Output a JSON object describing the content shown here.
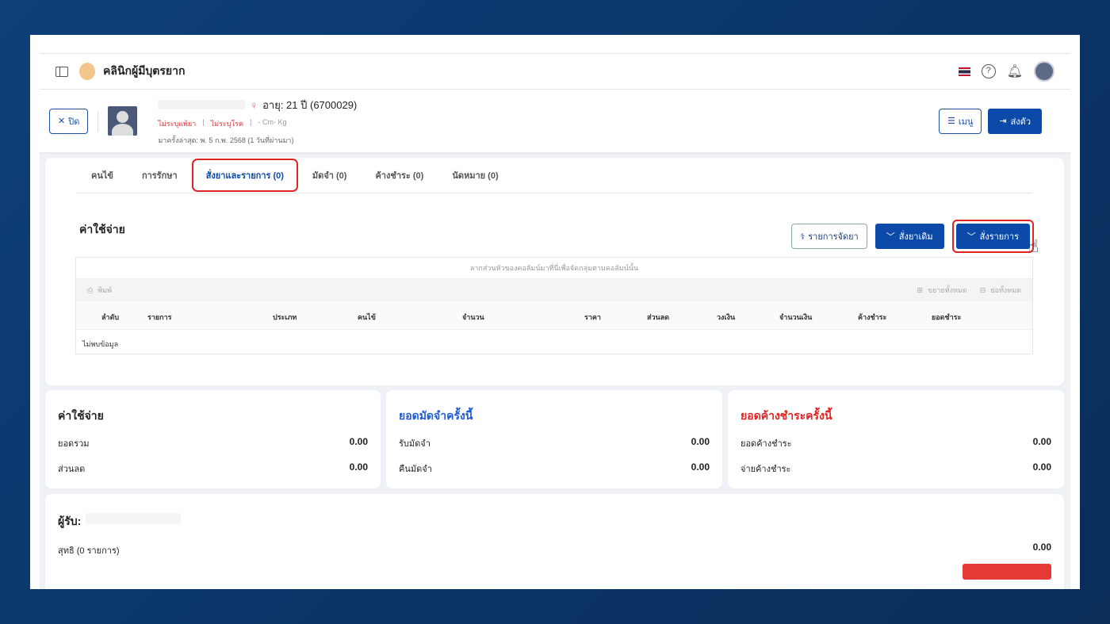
{
  "header": {
    "title": "คลินิกผู้มีบุตรยาก"
  },
  "patient": {
    "close_label": "ปิด",
    "age": "อายุ: 21 ปี (6700029)",
    "allergy": "ไม่ระบุแพ้ยา",
    "disease": "ไม่ระบุโรค",
    "size": "- Cm- Kg",
    "last_visit": "มาครั้งล่าสุด: พ. 5 ก.พ. 2568 (1 วันที่ผ่านมา)",
    "menu_label": "เมนู",
    "send_label": "ส่งตัว"
  },
  "tabs": [
    "คนไข้",
    "การรักษา",
    "สั่งยาและรายการ (0)",
    "มัดจำ (0)",
    "ค้างชำระ (0)",
    "นัดหมาย (0)"
  ],
  "section": {
    "title": "ค่าใช้จ่าย",
    "btn_dispense": "รายการจัดยา",
    "btn_old_drug": "สั่งยาเดิม",
    "btn_order": "สั่งรายการ"
  },
  "grid": {
    "group_hint": "ลากส่วนหัวของคอลัมน์มาที่นี่เพื่อจัดกลุ่มตามคอลัมน์นั้น",
    "print": "พิมพ์",
    "expand_all": "ขยายทั้งหมด",
    "collapse_all": "ย่อทั้งหมด",
    "columns": [
      "ลำดับ",
      "รายการ",
      "ประเภท",
      "คนไข้",
      "จำนวน",
      "ราคา",
      "ส่วนลด",
      "วงเงิน",
      "จำนวนเงิน",
      "ค้างชำระ",
      "ยอดชำระ"
    ],
    "empty": "ไม่พบข้อมูล"
  },
  "summary": [
    {
      "title": "ค่าใช้จ่าย",
      "color": "#222222",
      "rows": [
        {
          "label": "ยอดรวม",
          "value": "0.00"
        },
        {
          "label": "ส่วนลด",
          "value": "0.00"
        }
      ]
    },
    {
      "title": "ยอดมัดจำครั้งนี้",
      "color": "#1e5bd8",
      "rows": [
        {
          "label": "รับมัดจำ",
          "value": "0.00"
        },
        {
          "label": "คืนมัดจำ",
          "value": "0.00"
        }
      ]
    },
    {
      "title": "ยอดค้างชำระครั้งนี้",
      "color": "#e02424",
      "rows": [
        {
          "label": "ยอดค้างชำระ",
          "value": "0.00"
        },
        {
          "label": "จ่ายค้างชำระ",
          "value": "0.00"
        }
      ]
    }
  ],
  "receiver": {
    "label": "ผู้รับ:",
    "net": "สุทธิ (0 รายการ)",
    "net_value": "0.00"
  }
}
